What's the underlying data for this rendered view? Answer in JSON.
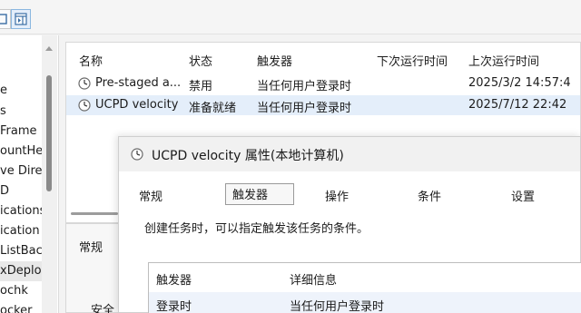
{
  "tree": {
    "items": [
      "e",
      "s",
      "Frame",
      "ountHe",
      "ve Direc",
      "D",
      "ications",
      "ication",
      "ListBacl",
      "xDeploy",
      "ochk",
      "ocker"
    ],
    "selected_index": 9
  },
  "task_list": {
    "columns": [
      "名称",
      "状态",
      "触发器",
      "下次运行时间",
      "上次运行时间"
    ],
    "rows": [
      {
        "name": "Pre-staged a...",
        "status": "禁用",
        "trigger": "当任何用户登录时",
        "next_run": "",
        "last_run": "2025/3/2 14:57:4"
      },
      {
        "name": "UCPD velocity",
        "status": "准备就绪",
        "trigger": "当任何用户登录时",
        "next_run": "",
        "last_run": "2025/7/12 22:42"
      }
    ],
    "selected_index": 1
  },
  "lower_pane": {
    "tab_label": "常规",
    "partial_label": "安全"
  },
  "dialog": {
    "title": "UCPD velocity 属性(本地计算机)",
    "tabs": [
      "常规",
      "触发器",
      "操作",
      "条件",
      "设置"
    ],
    "active_tab": "触发器",
    "description": "创建任务时，可以指定触发该任务的条件。",
    "trigger_table": {
      "columns": [
        "触发器",
        "详细信息"
      ],
      "rows": [
        {
          "trigger": "登录时",
          "details": "当任何用户登录时"
        }
      ]
    }
  },
  "colors": {
    "selection": "#e4eefa",
    "row_highlight": "#eef3fb",
    "background": "#f3f3f3"
  }
}
